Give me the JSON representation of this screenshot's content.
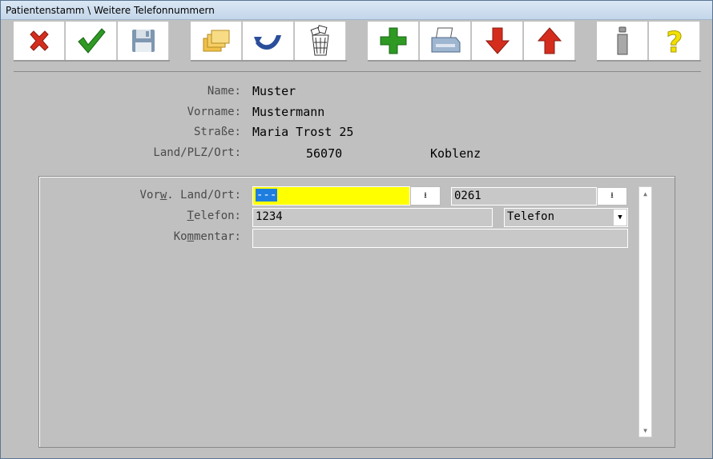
{
  "window": {
    "title": "Patientenstamm \\ Weitere Telefonnummern"
  },
  "toolbar": {
    "buttons": [
      {
        "name": "cancel-button",
        "icon": "red-x-icon"
      },
      {
        "name": "confirm-button",
        "icon": "green-check-icon"
      },
      {
        "name": "save-button",
        "icon": "floppy-disk-icon"
      },
      {
        "name": "open-folder-button",
        "icon": "folders-icon"
      },
      {
        "name": "undo-button",
        "icon": "undo-arrow-icon"
      },
      {
        "name": "delete-button",
        "icon": "trash-bin-icon"
      },
      {
        "name": "add-button",
        "icon": "green-plus-icon"
      },
      {
        "name": "print-button",
        "icon": "printer-icon"
      },
      {
        "name": "move-down-button",
        "icon": "red-arrow-down-icon"
      },
      {
        "name": "move-up-button",
        "icon": "red-arrow-up-icon"
      },
      {
        "name": "info-button",
        "icon": "info-pillar-icon"
      },
      {
        "name": "help-button",
        "icon": "question-mark-icon"
      }
    ]
  },
  "patient": {
    "name_label": "Name:",
    "name_value": "Muster",
    "vorname_label": "Vorname:",
    "vorname_value": "Mustermann",
    "strasse_label": "Straße:",
    "strasse_value": "Maria Trost 25",
    "lpo_label": "Land/PLZ/Ort:",
    "plz_value": "56070",
    "ort_value": "Koblenz"
  },
  "form": {
    "vorw_label_pre": "Vor",
    "vorw_label_mn": "w",
    "vorw_label_post": ". Land/Ort:",
    "land_value": "---",
    "ort_value": "0261",
    "telefon_label_mn": "T",
    "telefon_label_post": "elefon:",
    "telefon_value": "1234",
    "type_value": "Telefon",
    "kommentar_label_pre": "Ko",
    "kommentar_label_mn": "m",
    "kommentar_label_post": "mentar:",
    "kommentar_value": ""
  },
  "colors": {
    "highlight": "#ffff00",
    "selection": "#1e7ee0",
    "background": "#c0c0c0"
  }
}
